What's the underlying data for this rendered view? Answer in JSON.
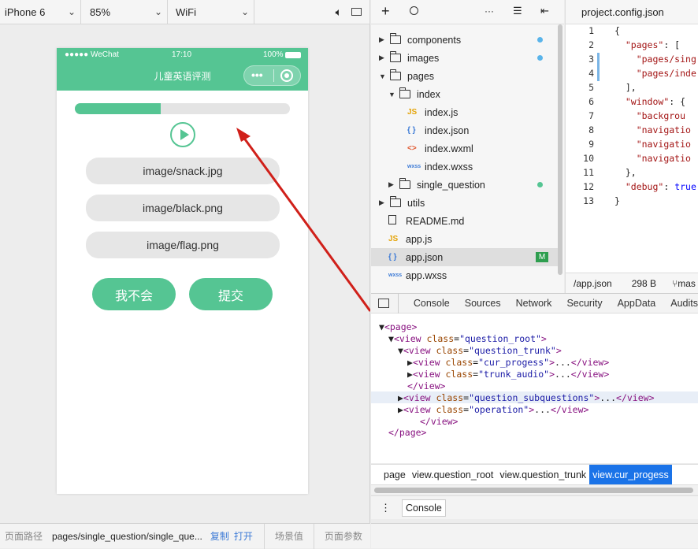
{
  "toolbar": {
    "device": "iPhone 6",
    "zoom": "85%",
    "network": "WiFi"
  },
  "phone": {
    "carrier": "●●●●● WeChat",
    "time": "17:10",
    "battery": "100%",
    "title": "儿童英语评测",
    "capsule_more": "•••",
    "progress": 0.4,
    "options": [
      "image/snack.jpg",
      "image/black.png",
      "image/flag.png"
    ],
    "btn_dontknow": "我不会",
    "btn_submit": "提交",
    "accent": "#55c593"
  },
  "sim_footer": {
    "path_label": "页面路径",
    "path_value": "pages/single_question/single_que...",
    "copy": "复制",
    "open": "打开",
    "scene": "场景值",
    "params": "页面参数"
  },
  "tree": {
    "items": [
      {
        "name": "components",
        "kind": "folder",
        "dot": "#5ab4ea"
      },
      {
        "name": "images",
        "kind": "folder",
        "dot": "#5ab4ea"
      },
      {
        "name": "pages",
        "kind": "folder-open"
      },
      {
        "name": "index",
        "kind": "folder-open"
      },
      {
        "name": "index.js",
        "icon": "JS"
      },
      {
        "name": "index.json",
        "icon": "{ }"
      },
      {
        "name": "index.wxml",
        "icon": "<>"
      },
      {
        "name": "index.wxss",
        "icon": "wxss"
      },
      {
        "name": "single_question",
        "kind": "folder",
        "dot": "#55c593"
      },
      {
        "name": "utils",
        "kind": "folder"
      },
      {
        "name": "README.md",
        "icon": "file"
      },
      {
        "name": "app.js",
        "icon": "JS"
      },
      {
        "name": "app.json",
        "icon": "{ }",
        "badge": "M"
      },
      {
        "name": "app.wxss",
        "icon": "wxss"
      }
    ]
  },
  "editor": {
    "tab": "project.config.json",
    "lines": [
      "{",
      "  \"pages\": [",
      "    \"pages/sing",
      "    \"pages/inde",
      "  ],",
      "  \"window\": {",
      "    \"backgrou",
      "    \"navigatio",
      "    \"navigatio",
      "    \"navigatio",
      "  },",
      "  \"debug\": true",
      "}"
    ],
    "status_file": "/app.json",
    "status_size": "298 B",
    "status_branch": "mas"
  },
  "devtools": {
    "tabs": [
      "Console",
      "Sources",
      "Network",
      "Security",
      "AppData",
      "Audits"
    ],
    "crumbs": [
      "page",
      "view.question_root",
      "view.question_trunk",
      "view.cur_progess"
    ],
    "console_tab": "Console"
  }
}
